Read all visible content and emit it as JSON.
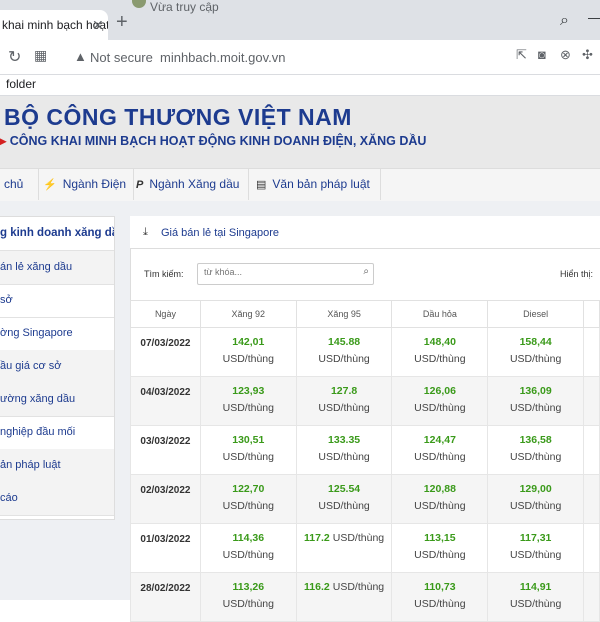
{
  "browser": {
    "active_tab_title": "khai minh bạch hoạt",
    "second_tab_title": "Vừa truy cập",
    "security_label": "Not secure",
    "url": "minhbach.moit.gov.vn",
    "bookmark_folder": "folder",
    "icons": [
      "reload-icon",
      "apps-icon",
      "warning-icon",
      "share-icon",
      "camera-icon",
      "shield-icon",
      "puzzle-icon",
      "search-icon"
    ]
  },
  "site": {
    "title": "BỘ CÔNG THƯƠNG VIỆT NAM",
    "subtitle": "CÔNG KHAI MINH BẠCH HOẠT ĐỘNG KINH DOANH ĐIỆN, XĂNG DẦU",
    "brand_color": "#1d3b8f",
    "nav": [
      {
        "label": "chủ"
      },
      {
        "icon": "⚡",
        "label": "Ngành Điện"
      },
      {
        "icon": "P",
        "label": "Ngành Xăng dầu"
      },
      {
        "icon": "▤",
        "label": "Văn bản pháp luật"
      }
    ]
  },
  "sidebar": {
    "heading": "g kinh doanh xăng dầu",
    "items": [
      "án lẻ xăng dầu",
      "sở",
      "ờng Singapore",
      "ầu giá cơ sở",
      "ường xăng dầu",
      "nghiệp đầu mối",
      "ản pháp luật",
      "cáo"
    ]
  },
  "panel": {
    "title": "Giá bán lẻ tại Singapore",
    "search_label": "Tìm kiếm:",
    "search_placeholder": "từ khóa...",
    "show_label": "Hiển thị:"
  },
  "table": {
    "headers": [
      "Ngày",
      "Xăng 92",
      "Xăng 95",
      "Dầu hỏa",
      "Diesel"
    ],
    "unit": "USD/thùng",
    "value_color": "#3a9a1a",
    "rows": [
      {
        "date": "07/03/2022",
        "x92": "142,01",
        "x95": "145.88",
        "dh": "148,40",
        "ds": "158,44"
      },
      {
        "date": "04/03/2022",
        "x92": "123,93",
        "x95": "127.8",
        "dh": "126,06",
        "ds": "136,09"
      },
      {
        "date": "03/03/2022",
        "x92": "130,51",
        "x95": "133.35",
        "dh": "124,47",
        "ds": "136,58"
      },
      {
        "date": "02/03/2022",
        "x92": "122,70",
        "x95": "125.54",
        "dh": "120,88",
        "ds": "129,00"
      },
      {
        "date": "01/03/2022",
        "x92": "114,36",
        "x95": "117.2",
        "dh": "113,15",
        "ds": "117,31"
      },
      {
        "date": "28/02/2022",
        "x92": "113,26",
        "x95": "116.2",
        "dh": "110,73",
        "ds": "114,91"
      }
    ]
  }
}
